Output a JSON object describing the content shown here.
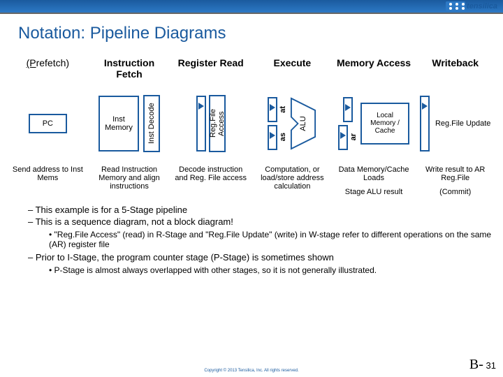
{
  "logo_text": "tensilica",
  "title": "Notation: Pipeline Diagrams",
  "stages": {
    "prefetch": "refetch)",
    "prefetch_prefix": "(P",
    "fetch": "Instruction Fetch",
    "regread": "Register Read",
    "execute": "Execute",
    "memacc": "Memory Access",
    "writeback": "Writeback"
  },
  "blocks": {
    "pc": "PC",
    "imem": "Inst Memory",
    "idecode": "Inst Decode",
    "rfaccess": "Reg.File Access",
    "at": "at",
    "as": "as",
    "alu": "ALU",
    "ar": "ar",
    "lmem": "Local Memory / Cache",
    "rfu": "Reg.File Update"
  },
  "descriptions": {
    "p": "Send address to Inst Mems",
    "f": "Read Instruction Memory and align instructions",
    "r": "Decode instruction and Reg. File access",
    "e": "Computation, or load/store address calculation",
    "m1": "Data Memory/Cache Loads",
    "m2": "Stage ALU result",
    "w1": "Write result to AR Reg.File",
    "w2": "(Commit)"
  },
  "bullets": {
    "b1": "This example is for a 5-Stage pipeline",
    "b2": "This is a sequence diagram, not a block diagram!",
    "b2a": "\"Reg.File Access\" (read) in R-Stage and \"Reg.File Update\" (write) in W-stage refer to different operations on the same (AR) register file",
    "b3": "Prior to I-Stage, the program counter stage (P-Stage) is sometimes shown",
    "b3a": "P-Stage is almost always overlapped with other stages, so it is not generally illustrated."
  },
  "footer": "Copyright © 2013  Tensilica, Inc. All rights reserved.",
  "page_prefix": "B-",
  "page_num": "31"
}
